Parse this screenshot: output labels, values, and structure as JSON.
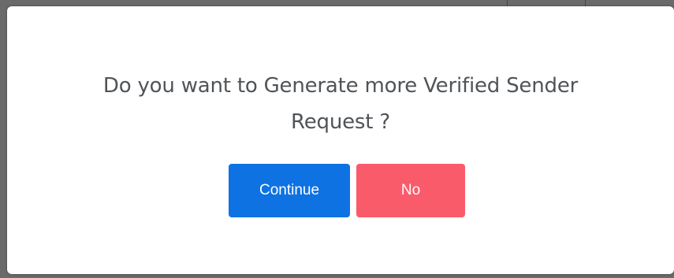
{
  "dialog": {
    "message_line1": "Do you want to Generate more Verified Sender",
    "message_line2": "Request ?",
    "continue_label": "Continue",
    "no_label": "No"
  },
  "colors": {
    "continue_button": "#0e72e3",
    "no_button": "#fa5b6a",
    "message_text": "#505458",
    "overlay": "#6a6a6a"
  }
}
